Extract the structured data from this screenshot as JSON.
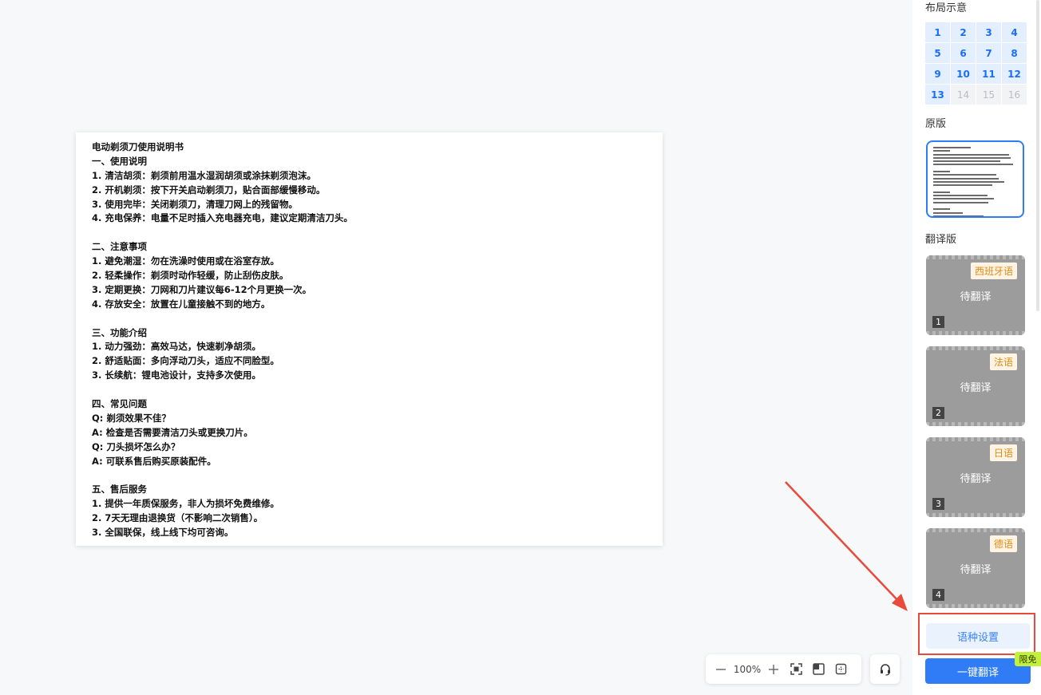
{
  "document": {
    "lines": [
      "电动剃须刀使用说明书",
      "一、使用说明",
      "1. 清洁胡须：剃须前用温水湿润胡须或涂抹剃须泡沫。",
      "2. 开机剃须：按下开关启动剃须刀，贴合面部缓慢移动。",
      "3. 使用完毕：关闭剃须刀，清理刀网上的残留物。",
      "4. 充电保养：电量不足时插入充电器充电，建议定期清洁刀头。",
      "",
      "二、注意事项",
      "1. 避免潮湿：勿在洗澡时使用或在浴室存放。",
      "2. 轻柔操作：剃须时动作轻缓，防止刮伤皮肤。",
      "3. 定期更换：刀网和刀片建议每6-12个月更换一次。",
      "4. 存放安全：放置在儿童接触不到的地方。",
      "",
      "三、功能介绍",
      "1. 动力强劲：高效马达，快速剃净胡须。",
      "2. 舒适贴面：多向浮动刀头，适应不同脸型。",
      "3. 长续航：锂电池设计，支持多次使用。",
      "",
      "四、常见问题",
      "Q: 剃须效果不佳？",
      "A: 检查是否需要清洁刀头或更换刀片。",
      "Q: 刀头损坏怎么办？",
      "A: 可联系售后购买原装配件。",
      "",
      "五、售后服务",
      "1. 提供一年质保服务，非人为损坏免费维修。",
      "2. 7天无理由退换货（不影响二次销售）。",
      "3. 全国联保，线上线下均可咨询。"
    ]
  },
  "toolbar": {
    "zoom": "100%",
    "zoom_out_icon": "minus-icon",
    "zoom_in_icon": "plus-icon",
    "fit_icon": "fit-screen-icon",
    "compare_icon": "split-view-icon",
    "fullscreen_icon": "crop-icon",
    "support_icon": "headset-icon"
  },
  "panel": {
    "layout_title": "布局示意",
    "layout_cells": [
      {
        "label": "1",
        "active": true
      },
      {
        "label": "2",
        "active": true
      },
      {
        "label": "3",
        "active": true
      },
      {
        "label": "4",
        "active": true
      },
      {
        "label": "5",
        "active": true
      },
      {
        "label": "6",
        "active": true
      },
      {
        "label": "7",
        "active": true
      },
      {
        "label": "8",
        "active": true
      },
      {
        "label": "9",
        "active": true
      },
      {
        "label": "10",
        "active": true
      },
      {
        "label": "11",
        "active": true
      },
      {
        "label": "12",
        "active": true
      },
      {
        "label": "13",
        "active": true
      },
      {
        "label": "14",
        "active": false
      },
      {
        "label": "15",
        "active": false
      },
      {
        "label": "16",
        "active": false
      }
    ],
    "original_title": "原版",
    "translated_title": "翻译版",
    "cards": [
      {
        "lang": "西班牙语",
        "status": "待翻译",
        "num": "1"
      },
      {
        "lang": "法语",
        "status": "待翻译",
        "num": "2"
      },
      {
        "lang": "日语",
        "status": "待翻译",
        "num": "3"
      },
      {
        "lang": "德语",
        "status": "待翻译",
        "num": "4"
      }
    ],
    "lang_settings": "语种设置",
    "translate_all": "一键翻译",
    "free_badge": "限免"
  },
  "colors": {
    "accent": "#2f7cf6",
    "annotation_red": "#e84b3c",
    "lang_tag": "#e08a16",
    "free_badge": "#c3f03a"
  }
}
